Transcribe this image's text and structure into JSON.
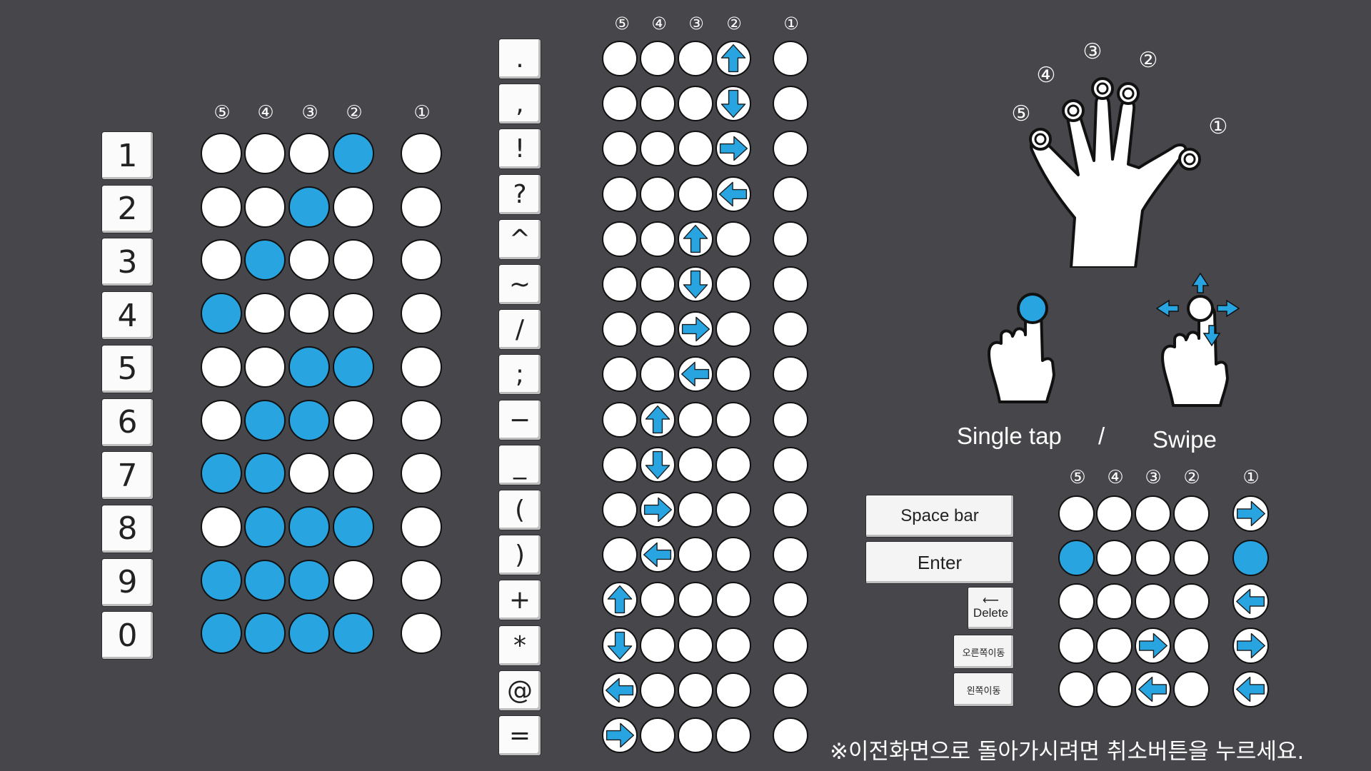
{
  "colors": {
    "background": "#47474b",
    "accent": "#28a4e0",
    "dot": "#ffffff"
  },
  "finger_marks": [
    "⑤",
    "④",
    "③",
    "②",
    "①"
  ],
  "numbers": {
    "keys": [
      {
        "label": "1",
        "pattern": "0001",
        "thumb": "none"
      },
      {
        "label": "2",
        "pattern": "0010",
        "thumb": "none"
      },
      {
        "label": "3",
        "pattern": "0100",
        "thumb": "none"
      },
      {
        "label": "4",
        "pattern": "1000",
        "thumb": "none"
      },
      {
        "label": "5",
        "pattern": "0011",
        "thumb": "none"
      },
      {
        "label": "6",
        "pattern": "0110",
        "thumb": "none"
      },
      {
        "label": "7",
        "pattern": "1100",
        "thumb": "none"
      },
      {
        "label": "8",
        "pattern": "0111",
        "thumb": "none"
      },
      {
        "label": "9",
        "pattern": "1110",
        "thumb": "none"
      },
      {
        "label": "0",
        "pattern": "1111",
        "thumb": "none"
      }
    ]
  },
  "symbols": {
    "keys": [
      {
        "label": ".",
        "finger": 2,
        "arrow": "up"
      },
      {
        "label": ",",
        "finger": 2,
        "arrow": "down"
      },
      {
        "label": "!",
        "finger": 2,
        "arrow": "right"
      },
      {
        "label": "?",
        "finger": 2,
        "arrow": "left"
      },
      {
        "label": "^",
        "finger": 3,
        "arrow": "up"
      },
      {
        "label": "~",
        "finger": 3,
        "arrow": "down"
      },
      {
        "label": "/",
        "finger": 3,
        "arrow": "right"
      },
      {
        "label": ";",
        "finger": 3,
        "arrow": "left"
      },
      {
        "label": "−",
        "finger": 4,
        "arrow": "up"
      },
      {
        "label": "_",
        "finger": 4,
        "arrow": "down"
      },
      {
        "label": "(",
        "finger": 4,
        "arrow": "right"
      },
      {
        "label": ")",
        "finger": 4,
        "arrow": "left"
      },
      {
        "label": "+",
        "finger": 5,
        "arrow": "up"
      },
      {
        "label": "*",
        "finger": 5,
        "arrow": "down"
      },
      {
        "label": "@",
        "finger": 5,
        "arrow": "left"
      },
      {
        "label": "=",
        "finger": 5,
        "arrow": "right"
      }
    ]
  },
  "gestures": {
    "hand_marks": [
      "⑤",
      "④",
      "③",
      "②",
      "①"
    ],
    "single_tap_label": "Single tap",
    "separator": "/",
    "swipe_label": "Swipe"
  },
  "controls": {
    "space_label": "Space bar",
    "enter_label": "Enter",
    "delete_label": "Delete",
    "move_right_label": "오른쪽이동",
    "move_left_label": "왼쪽이동",
    "rows": [
      {
        "name": "space",
        "finger": 0,
        "arrow": "none",
        "thumb": "right"
      },
      {
        "name": "enter",
        "finger": 5,
        "arrow": "blue",
        "thumb": "blue"
      },
      {
        "name": "delete",
        "finger": 0,
        "arrow": "none",
        "thumb": "left"
      },
      {
        "name": "move-right",
        "finger": 3,
        "arrow": "right",
        "thumb": "right"
      },
      {
        "name": "move-left",
        "finger": 3,
        "arrow": "left",
        "thumb": "left"
      }
    ]
  },
  "note": "※이전화면으로 돌아가시려면 취소버튼을 누르세요."
}
